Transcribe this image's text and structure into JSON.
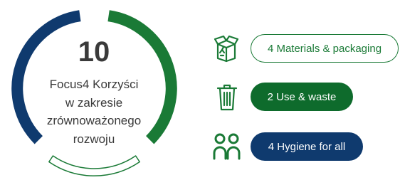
{
  "summary": {
    "count": "10",
    "description_lines": [
      "Focus4 Korzyści",
      "w zakresie",
      "zrównoważonego",
      "rozwoju"
    ]
  },
  "progress_ring": {
    "colors": {
      "green": "#1a7a36",
      "navy": "#0f3a6e",
      "track": "#1a7a36"
    }
  },
  "categories": [
    {
      "icon": "recycling-box-icon",
      "label": "4 Materials & packaging",
      "style": "outline",
      "color": "#1a7a36"
    },
    {
      "icon": "trash-bin-icon",
      "label": "2 Use & waste",
      "style": "filled",
      "color": "#0e6b2c"
    },
    {
      "icon": "people-icon",
      "label": "4 Hygiene for all",
      "style": "filled",
      "color": "#0f3a6e"
    }
  ]
}
